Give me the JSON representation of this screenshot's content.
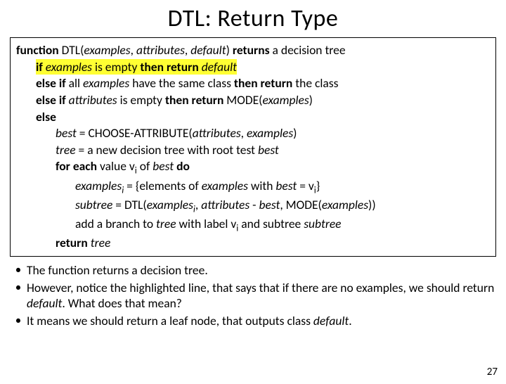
{
  "title": "DTL: Return Type",
  "code": {
    "l1_a": "function",
    "l1_b": " DTL(",
    "l1_c": "examples",
    "l1_d": ", ",
    "l1_e": "attributes",
    "l1_f": ", ",
    "l1_g": "default",
    "l1_h": ") ",
    "l1_i": "returns",
    "l1_j": " a decision tree",
    "l2_a": "if ",
    "l2_b": "examples",
    "l2_c": " is empty ",
    "l2_d": "then return ",
    "l2_e": "default",
    "l3_a": "else if",
    "l3_b": " all ",
    "l3_c": "examples",
    "l3_d": " have the same class ",
    "l3_e": "then return",
    "l3_f": " the class",
    "l4_a": "else if ",
    "l4_b": "attributes",
    "l4_c": " is empty ",
    "l4_d": "then return",
    "l4_e": " MODE(",
    "l4_f": "examples",
    "l4_g": ")",
    "l5_a": "else",
    "l6_a": "best",
    "l6_b": " = CHOOSE-ATTRIBUTE(",
    "l6_c": "attributes",
    "l6_d": ", ",
    "l6_e": "examples",
    "l6_f": ")",
    "l7_a": "tree",
    "l7_b": " = a new decision tree with root test ",
    "l7_c": "best",
    "l8_a": "for each",
    "l8_b": " value v",
    "l8_c": "i",
    "l8_d": " of ",
    "l8_e": "best ",
    "l8_f": "do",
    "l9_a": "examples",
    "l9_b": "i",
    "l9_c": " = {elements of ",
    "l9_d": "examples",
    "l9_e": " with ",
    "l9_f": "best",
    "l9_g": " = v",
    "l9_h": "i",
    "l9_i": "}",
    "l10_a": "subtree",
    "l10_b": " = DTL(",
    "l10_c": "examples",
    "l10_d": "i",
    "l10_e": ", ",
    "l10_f": "attributes",
    "l10_g": " - ",
    "l10_h": "best",
    "l10_i": ", MODE(",
    "l10_j": "examples",
    "l10_k": "))",
    "l11_a": "add a branch to ",
    "l11_b": "tree",
    "l11_c": " with label v",
    "l11_d": "i",
    "l11_e": " and subtree ",
    "l11_f": "subtree",
    "l12_a": "return ",
    "l12_b": "tree"
  },
  "bullets": {
    "b1": "The function returns a decision tree.",
    "b2_a": "However, notice the highlighted line, that says that if there are no examples, we should return ",
    "b2_b": "default",
    "b2_c": ". What does that mean?",
    "b3_a": "It means we should return a leaf node, that outputs class ",
    "b3_b": "default",
    "b3_c": "."
  },
  "pagenum": "27"
}
